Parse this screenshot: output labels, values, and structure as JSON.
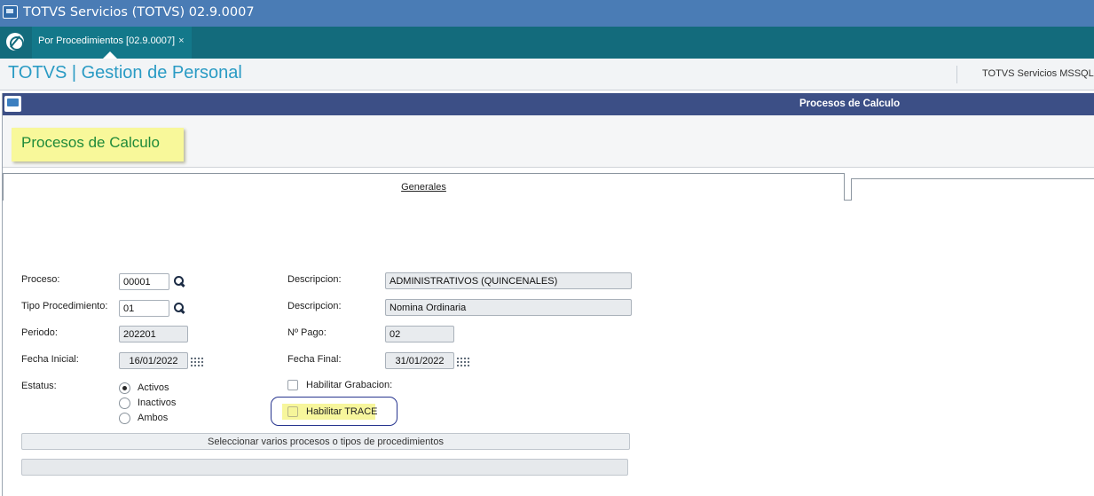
{
  "window": {
    "title": "TOTVS Servicios (TOTVS) 02.9.0007"
  },
  "tabs": [
    {
      "label": "Por Procedimientos [02.9.0007]",
      "close": "×"
    }
  ],
  "module": {
    "title": "TOTVS | Gestion de Personal",
    "server": "TOTVS Servicios MSSQL I"
  },
  "dialog": {
    "title": "Procesos de Calculo",
    "header_badge": "Procesos de Calculo",
    "tab_generales": "Generales"
  },
  "form": {
    "proceso": {
      "label": "Proceso:",
      "value": "00001"
    },
    "descripcion1": {
      "label": "Descripcion:",
      "value": "ADMINISTRATIVOS (QUINCENALES)"
    },
    "tipo_procedimiento": {
      "label": "Tipo Procedimiento:",
      "value": "01"
    },
    "descripcion2": {
      "label": "Descripcion:",
      "value": "Nomina Ordinaria"
    },
    "periodo": {
      "label": "Periodo:",
      "value": "202201"
    },
    "nro_pago": {
      "label": "Nº Pago:",
      "value": "02"
    },
    "fecha_inicial": {
      "label": "Fecha Inicial:",
      "value": "16/01/2022"
    },
    "fecha_final": {
      "label": "Fecha Final:",
      "value": "31/01/2022"
    },
    "estatus": {
      "label": "Estatus:",
      "options": [
        "Activos",
        "Inactivos",
        "Ambos"
      ],
      "selected": "Activos"
    },
    "habilitar_grabacion": {
      "label": "Habilitar Grabacion:",
      "checked": false
    },
    "habilitar_trace": {
      "label": "Habilitar TRACE",
      "checked": false
    },
    "select_button": "Seleccionar varios procesos o tipos de procedimientos"
  },
  "colors": {
    "titlebar": "#4a7cb5",
    "tabbar": "#136b7c",
    "module_title": "#2a9bc4",
    "dialog_bar": "#3c4f86",
    "badge_bg": "#f8f89a",
    "badge_text": "#1f8a3a",
    "trace_ring": "#27358f"
  }
}
